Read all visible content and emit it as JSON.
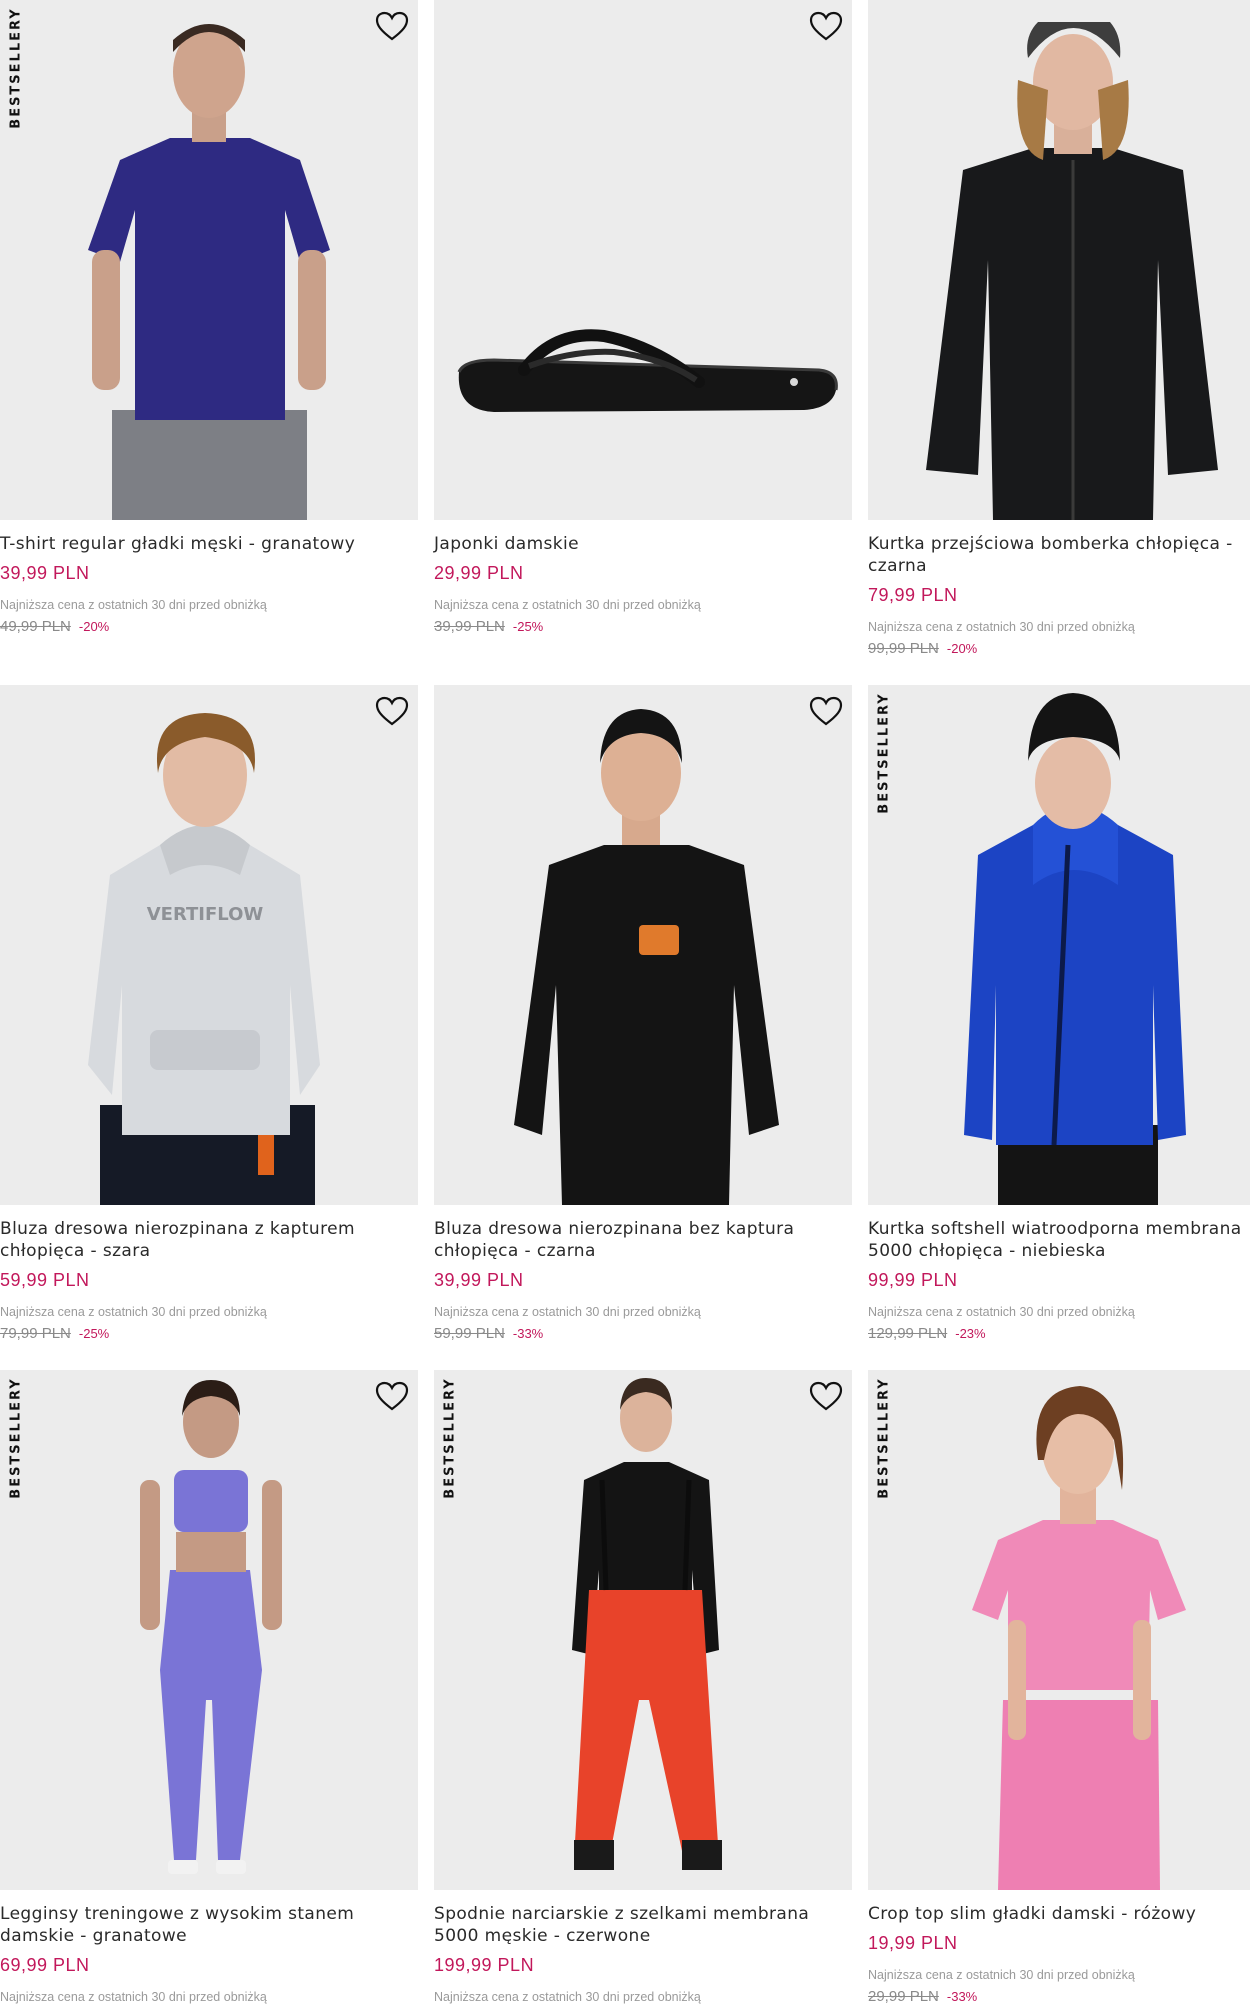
{
  "badge_text": "BESTSELLERY",
  "icons": {
    "favorite": "heart-outline-icon"
  },
  "colors": {
    "price": "#c2185b",
    "muted": "#9a9a9a"
  },
  "products": [
    {
      "name": "T-shirt regular gładki męski - granatowy",
      "price": "39,99 PLN",
      "lowest_note": "Najniższa cena z ostatnich 30 dni przed obniżką",
      "old_price": "49,99 PLN",
      "discount": "-20%"
    },
    {
      "name": "Japonki damskie",
      "price": "29,99 PLN",
      "lowest_note": "Najniższa cena z ostatnich 30 dni przed obniżką",
      "old_price": "39,99 PLN",
      "discount": "-25%"
    },
    {
      "name": "Kurtka przejściowa bomberka chłopięca - czarna",
      "price": "79,99 PLN",
      "lowest_note": "Najniższa cena z ostatnich 30 dni przed obniżką",
      "old_price": "99,99 PLN",
      "discount": "-20%"
    },
    {
      "name": "Bluza dresowa nierozpinana z kapturem chłopięca - szara",
      "price": "59,99 PLN",
      "lowest_note": "Najniższa cena z ostatnich 30 dni przed obniżką",
      "old_price": "79,99 PLN",
      "discount": "-25%",
      "print_text": "VERTIFLOW"
    },
    {
      "name": "Bluza dresowa nierozpinana bez kaptura chłopięca - czarna",
      "price": "39,99 PLN",
      "lowest_note": "Najniższa cena z ostatnich 30 dni przed obniżką",
      "old_price": "59,99 PLN",
      "discount": "-33%"
    },
    {
      "name": "Kurtka softshell wiatroodporna membrana 5000 chłopięca - niebieska",
      "price": "99,99 PLN",
      "lowest_note": "Najniższa cena z ostatnich 30 dni przed obniżką",
      "old_price": "129,99 PLN",
      "discount": "-23%"
    },
    {
      "name": "Legginsy treningowe z wysokim stanem damskie - granatowe",
      "price": "69,99 PLN",
      "lowest_note": "Najniższa cena z ostatnich 30 dni przed obniżką"
    },
    {
      "name": "Spodnie narciarskie z szelkami membrana 5000 męskie - czerwone",
      "price": "199,99 PLN",
      "lowest_note": "Najniższa cena z ostatnich 30 dni przed obniżką"
    },
    {
      "name": "Crop top slim gładki damski - różowy",
      "price": "19,99 PLN",
      "lowest_note": "Najniższa cena z ostatnich 30 dni przed obniżką",
      "old_price": "29,99 PLN",
      "discount": "-33%"
    }
  ]
}
